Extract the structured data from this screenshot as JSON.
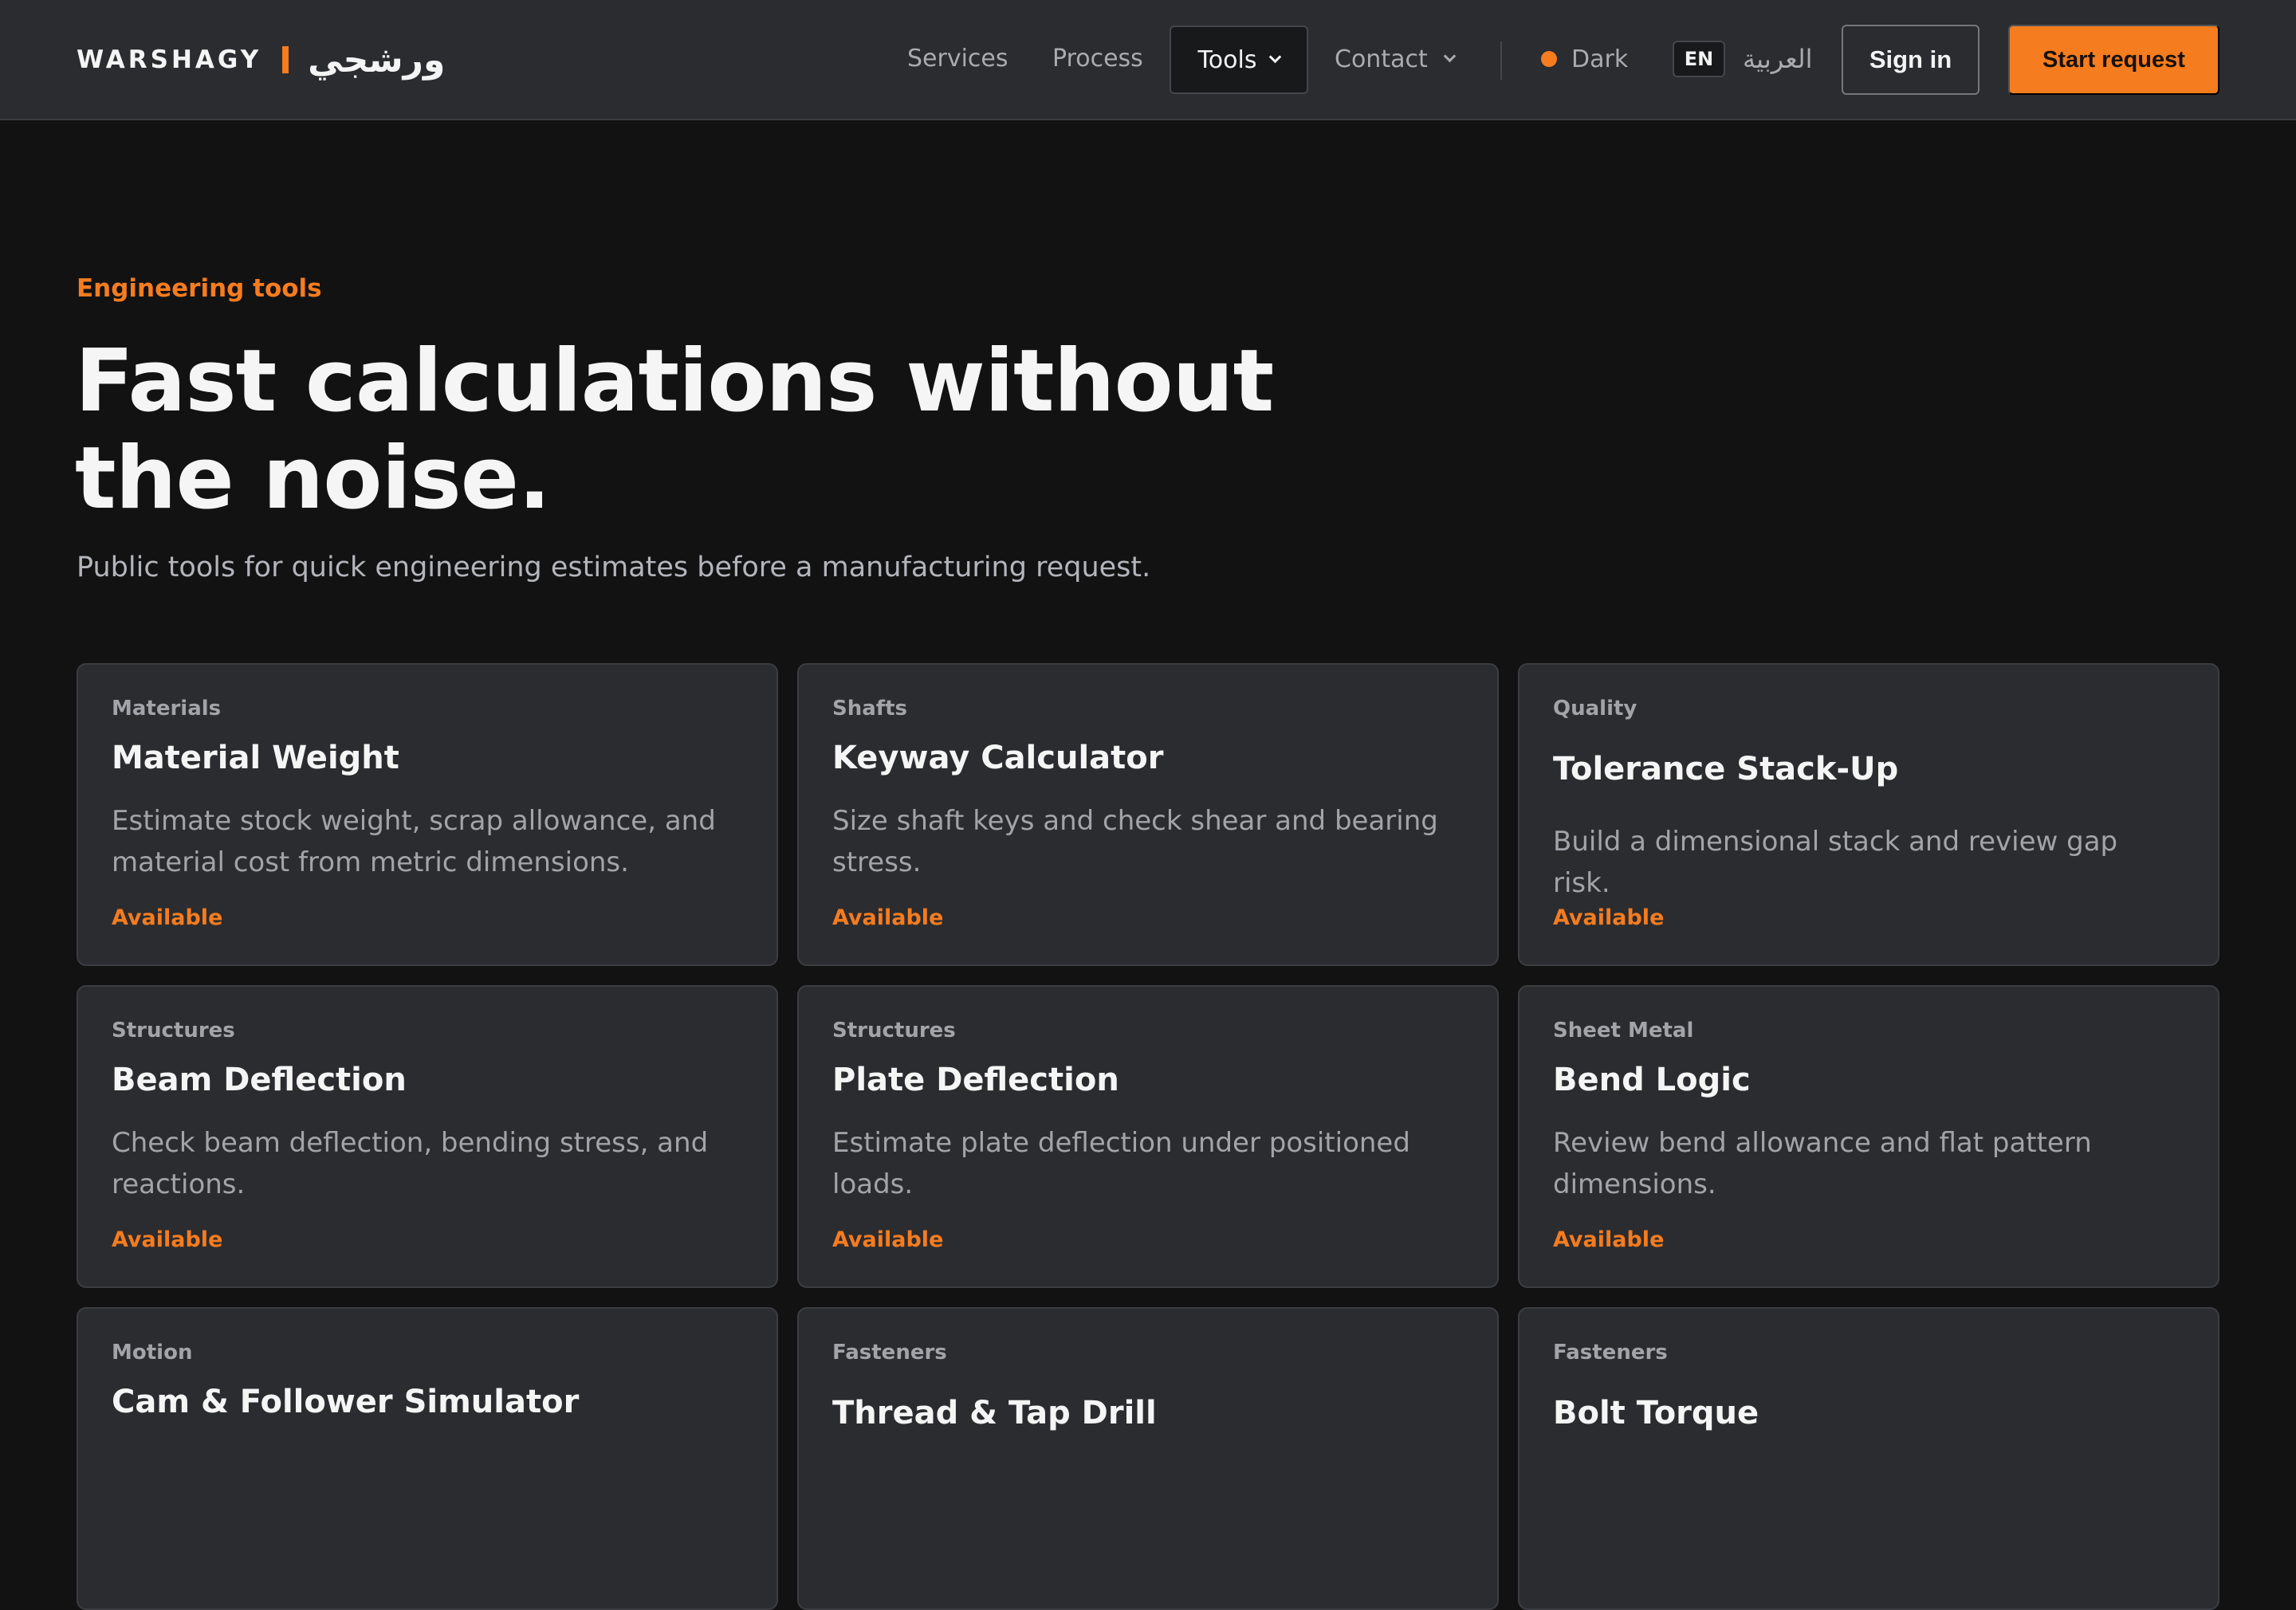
{
  "header": {
    "brand_latin": "WARSHAGY",
    "brand_arabic": "ورشجي",
    "nav": {
      "services": "Services",
      "process": "Process",
      "tools": "Tools",
      "contact": "Contact"
    },
    "theme_label": "Dark",
    "lang_current": "EN",
    "lang_alternate": "العربية",
    "signin_label": "Sign in",
    "cta_label": "Start request"
  },
  "hero": {
    "eyebrow": "Engineering tools",
    "title_line1": "Fast calculations without",
    "title_line2": "the noise.",
    "subtitle": "Public tools for quick engineering estimates before a manufacturing request."
  },
  "tools": [
    {
      "category": "Materials",
      "title": "Material Weight",
      "description": "Estimate stock weight, scrap allowance, and material cost from metric dimensions.",
      "status": "Available"
    },
    {
      "category": "Shafts",
      "title": "Keyway Calculator",
      "description": "Size shaft keys and check shear and bearing stress.",
      "status": "Available"
    },
    {
      "category": "Quality",
      "title": "Tolerance Stack-Up",
      "description": "Build a dimensional stack and review gap risk.",
      "status": "Available"
    },
    {
      "category": "Structures",
      "title": "Beam Deflection",
      "description": "Check beam deflection, bending stress, and reactions.",
      "status": "Available"
    },
    {
      "category": "Structures",
      "title": "Plate Deflection",
      "description": "Estimate plate deflection under positioned loads.",
      "status": "Available"
    },
    {
      "category": "Sheet Metal",
      "title": "Bend Logic",
      "description": "Review bend allowance and flat pattern dimensions.",
      "status": "Available"
    },
    {
      "category": "Motion",
      "title": "Cam & Follower Simulator",
      "description": "",
      "status": ""
    },
    {
      "category": "Fasteners",
      "title": "Thread & Tap Drill",
      "description": "",
      "status": ""
    },
    {
      "category": "Fasteners",
      "title": "Bolt Torque",
      "description": "",
      "status": ""
    }
  ],
  "colors": {
    "accent": "#f57c1f",
    "page_background": "#121213",
    "surface": "#2b2c30"
  }
}
